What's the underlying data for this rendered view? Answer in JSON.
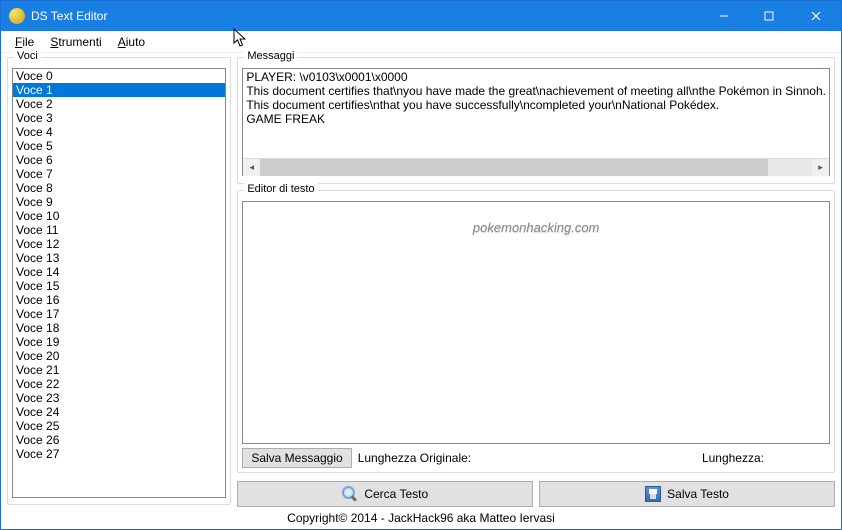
{
  "window": {
    "title": "DS Text Editor"
  },
  "menu": {
    "file": "File",
    "strumenti": "Strumenti",
    "aiuto": "Aiuto"
  },
  "voci": {
    "label": "Voci",
    "items": [
      "Voce 0",
      "Voce 1",
      "Voce 2",
      "Voce 3",
      "Voce 4",
      "Voce 5",
      "Voce 6",
      "Voce 7",
      "Voce 8",
      "Voce 9",
      "Voce 10",
      "Voce 11",
      "Voce 12",
      "Voce 13",
      "Voce 14",
      "Voce 15",
      "Voce 16",
      "Voce 17",
      "Voce 18",
      "Voce 19",
      "Voce 20",
      "Voce 21",
      "Voce 22",
      "Voce 23",
      "Voce 24",
      "Voce 25",
      "Voce 26",
      "Voce 27"
    ],
    "selected": 1
  },
  "messaggi": {
    "label": "Messaggi",
    "lines": [
      "PLAYER: \\v0103\\x0001\\x0000",
      "This document certifies that\\nyou have made the great\\nachievement of meeting all\\nthe Pokémon in Sinnoh.",
      "This document certifies\\nthat you have successfully\\ncompleted your\\nNational Pokédex.",
      "GAME FREAK"
    ]
  },
  "editor": {
    "label": "Editor di testo",
    "watermark": "pokemonhacking.com",
    "value": ""
  },
  "controls": {
    "salva_messaggio": "Salva Messaggio",
    "lunghezza_originale": "Lunghezza Originale:",
    "lunghezza": "Lunghezza:",
    "cerca_testo": "Cerca Testo",
    "salva_testo": "Salva Testo"
  },
  "footer": {
    "copyright": "Copyright© 2014 - JackHack96 aka Matteo Iervasi"
  }
}
